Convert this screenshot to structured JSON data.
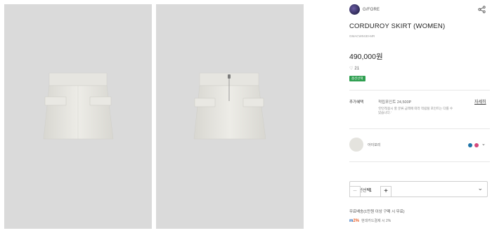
{
  "product": {
    "brand": "G/FORE",
    "title": "CORDUROY SKIRT (WOMEN)",
    "sku": "GMACW0430-MR",
    "price": "490,000원",
    "likes_count": "21",
    "badge": "옵션선택",
    "points_label": "추가혜택",
    "points_value": "적립포인트 24,500P",
    "points_note": "'한인적용시 할 분류 금액에 따라 적립될 포인트는 다를 수 있습니다.'",
    "points_detail_link": "자세히",
    "color_name": "아이보리",
    "color_options": [
      "#1e74a8",
      "#d5497b"
    ],
    "swatch_color": "#e4e3de",
    "option_select_label": "옵션선택",
    "quantity": "1",
    "shipping_note": "무료배송(1만원 이상 구매 시 무료)",
    "promo_text": "현대카드결제 시 2%"
  },
  "icons": {
    "share": "share-icon",
    "heart": "heart-icon",
    "chevron": "chevron-down-icon"
  },
  "colors": {
    "badge": "#2e9f50",
    "image_bg": "#dadada"
  }
}
